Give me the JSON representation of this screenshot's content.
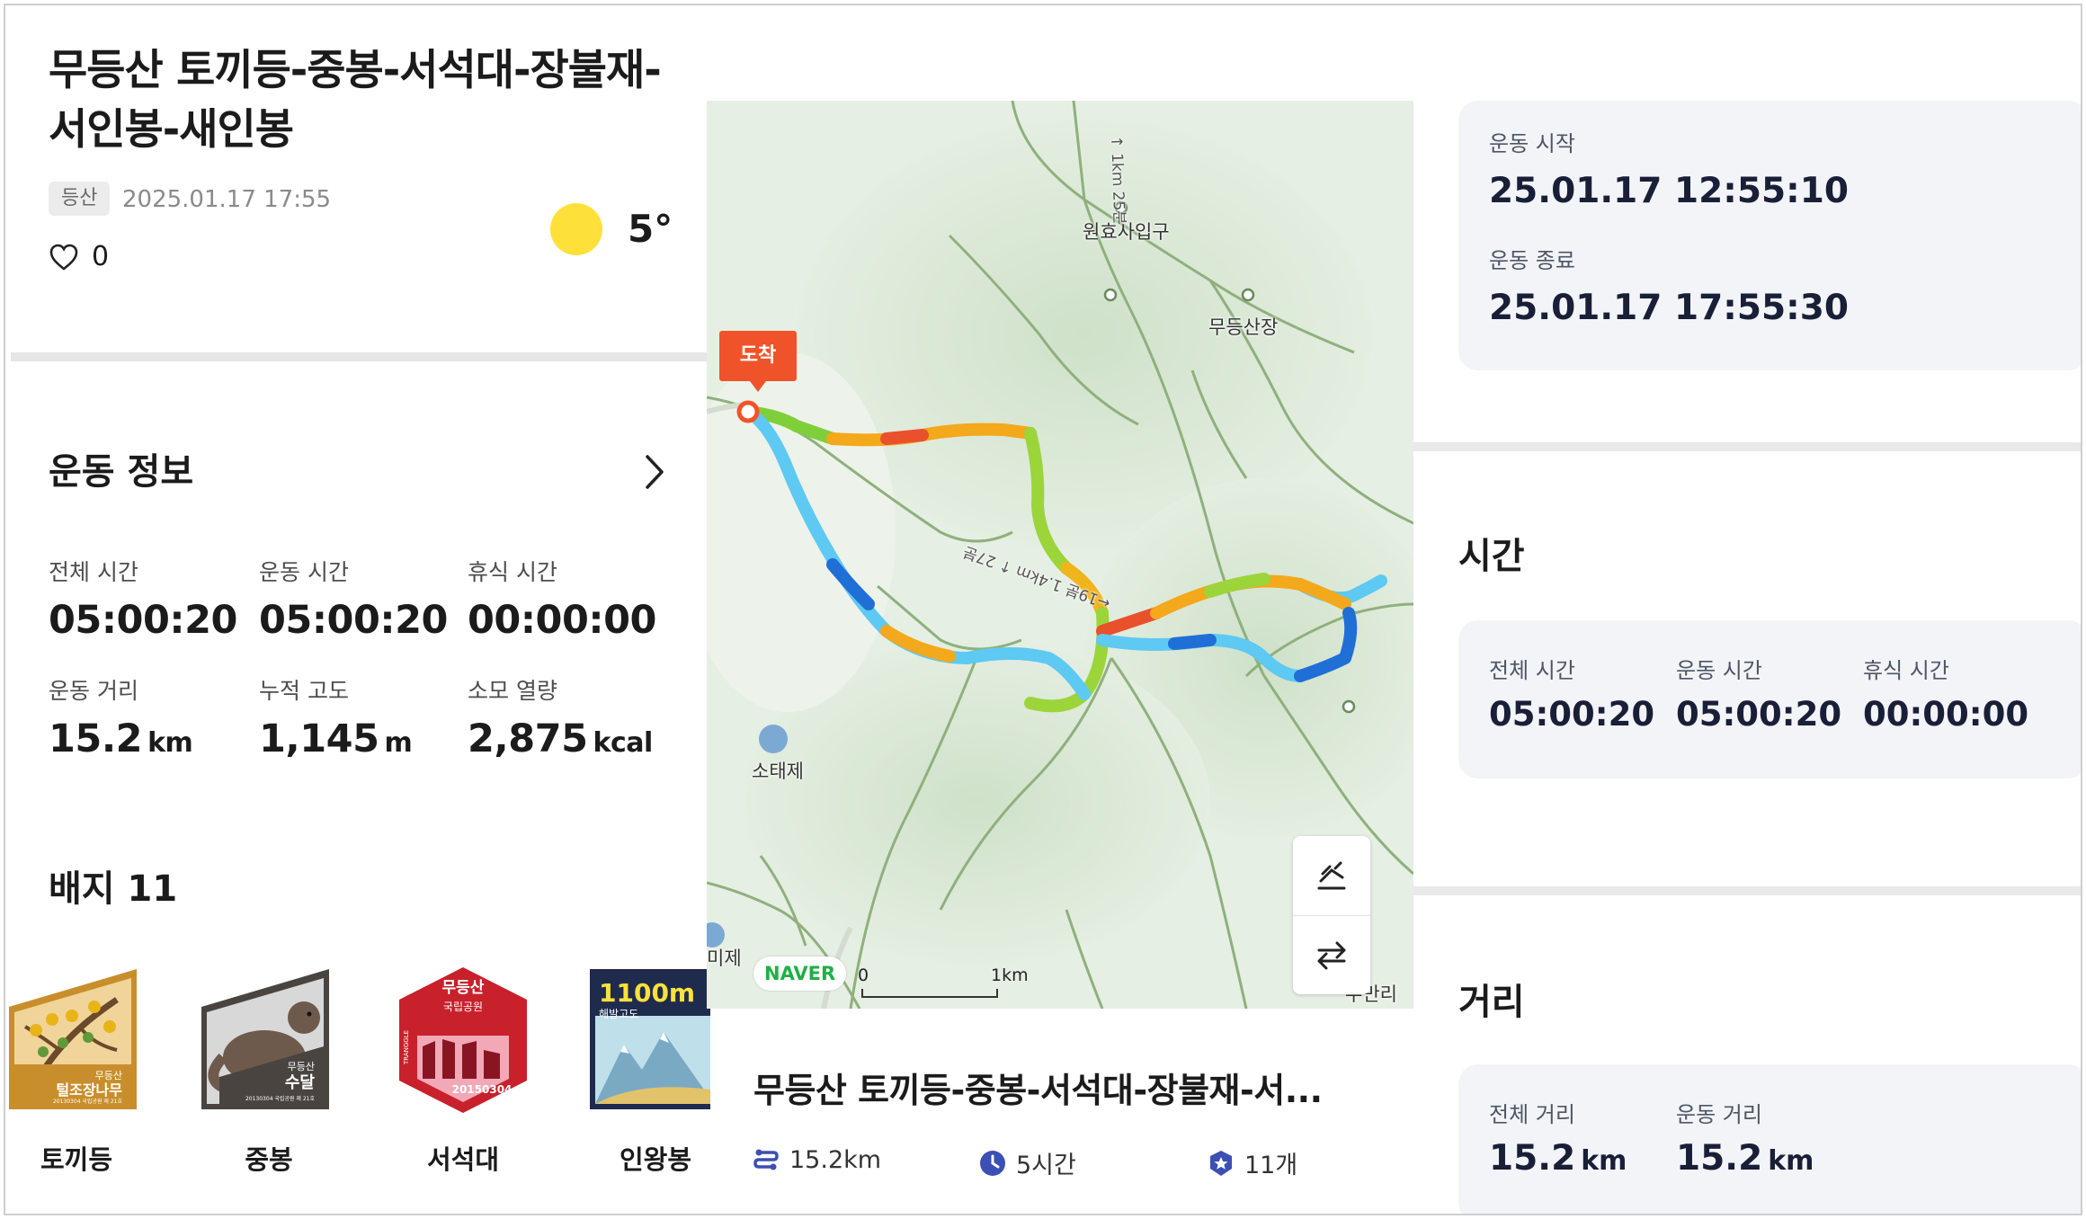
{
  "activity": {
    "title": "무등산 토끼등-중봉-서석대-장불재-서인봉-새인봉",
    "category": "등산",
    "datetime": "2025.01.17 17:55",
    "likes": "0",
    "temperature": "5°"
  },
  "exercise_info": {
    "title": "운동 정보",
    "stats": [
      {
        "label": "전체 시간",
        "value": "05:00:20",
        "unit": ""
      },
      {
        "label": "운동 시간",
        "value": "05:00:20",
        "unit": ""
      },
      {
        "label": "휴식 시간",
        "value": "00:00:00",
        "unit": ""
      },
      {
        "label": "운동 거리",
        "value": "15.2",
        "unit": "km"
      },
      {
        "label": "누적 고도",
        "value": "1,145",
        "unit": "m"
      },
      {
        "label": "소모 열량",
        "value": "2,875",
        "unit": "kcal"
      }
    ]
  },
  "badges": {
    "title": "배지 11",
    "items": [
      {
        "name": "토끼등",
        "badge_text_top": "무등산",
        "badge_text": "털조장나무",
        "badge_small": "20130304 국립공원 제 21호"
      },
      {
        "name": "중봉",
        "badge_text_top": "무등산",
        "badge_text": "수달",
        "badge_small": "20130304 국립공원 제 21호"
      },
      {
        "name": "서석대",
        "badge_text_top": "무등산",
        "badge_text": "국립공원",
        "badge_small": "20150304",
        "badge_side": "TRANGGLE"
      },
      {
        "name": "인왕봉",
        "badge_text_top": "1100m",
        "badge_text": "해발고도"
      }
    ]
  },
  "map": {
    "pin_label": "도착",
    "labels": [
      "원효사입구",
      "무등산장",
      "소태제",
      "미제",
      "수만리"
    ],
    "road_labels": [
      "↑ 1km 25분",
      "←19분 1.4km ↑ 27분"
    ],
    "provider": "NAVER",
    "scale_zero": "0",
    "scale_km": "1km",
    "controls": [
      "elevation-toggle",
      "swap-route"
    ]
  },
  "route_card": {
    "title": "무등산 토끼등-중봉-서석대-장불재-서...",
    "distance": "15.2km",
    "duration": "5시간",
    "badge_count": "11개"
  },
  "right_panel": {
    "start_label": "운동 시작",
    "start_value": "25.01.17 12:55:10",
    "end_label": "운동 종료",
    "end_value": "25.01.17 17:55:30",
    "time_title": "시간",
    "time": [
      {
        "label": "전체 시간",
        "value": "05:00:20"
      },
      {
        "label": "운동 시간",
        "value": "05:00:20"
      },
      {
        "label": "휴식 시간",
        "value": "00:00:00"
      }
    ],
    "distance_title": "거리",
    "distance": [
      {
        "label": "전체 거리",
        "value": "15.2",
        "unit": "km"
      },
      {
        "label": "운동 거리",
        "value": "15.2",
        "unit": "km"
      }
    ]
  },
  "colors": {
    "accent_orange": "#f0532a",
    "naver_green": "#1fb046",
    "sun_yellow": "#fde13a",
    "card_bg": "#f2f4f8",
    "navy_text": "#1a1f38"
  }
}
